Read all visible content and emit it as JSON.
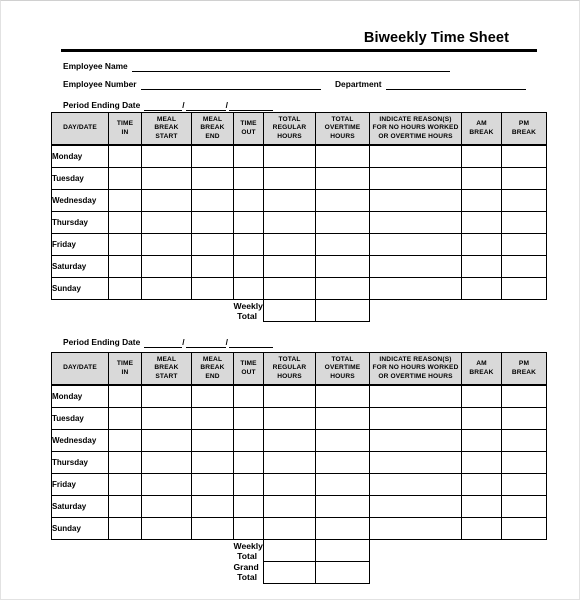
{
  "document": {
    "title": "Biweekly Time Sheet"
  },
  "header": {
    "employee_name_label": "Employee Name",
    "employee_name_value": "",
    "employee_number_label": "Employee Number",
    "employee_number_value": "",
    "department_label": "Department",
    "department_value": "",
    "period_ending_date_label": "Period Ending Date",
    "date_separator": "/"
  },
  "columns": [
    "DAY/DATE",
    "TIME IN",
    "MEAL BREAK START",
    "MEAL BREAK END",
    "TIME OUT",
    "TOTAL REGULAR HOURS",
    "TOTAL OVERTIME HOURS",
    "INDICATE REASON(S) FOR NO HOURS WORKED OR OVERTIME HOURS",
    "AM BREAK",
    "PM BREAK"
  ],
  "column_lines": {
    "day_date": [
      "DAY/DATE"
    ],
    "time_in": [
      "TIME",
      "IN"
    ],
    "meal_break_start": [
      "MEAL",
      "BREAK",
      "START"
    ],
    "meal_break_end": [
      "MEAL",
      "BREAK",
      "END"
    ],
    "time_out": [
      "TIME",
      "OUT"
    ],
    "total_regular_hours": [
      "TOTAL",
      "REGULAR",
      "HOURS"
    ],
    "total_overtime_hours": [
      "TOTAL",
      "OVERTIME",
      "HOURS"
    ],
    "indicate_reasons": [
      "INDICATE REASON(S)",
      "FOR NO HOURS WORKED",
      "OR OVERTIME HOURS"
    ],
    "am_break": [
      "AM",
      "BREAK"
    ],
    "pm_break": [
      "PM",
      "BREAK"
    ]
  },
  "period1": {
    "period_ending_date_label": "Period Ending Date",
    "rows": [
      {
        "day": "Monday",
        "time_in": "",
        "meal_break_start": "",
        "meal_break_end": "",
        "time_out": "",
        "total_regular_hours": "",
        "total_overtime_hours": "",
        "reason": "",
        "am_break": "",
        "pm_break": ""
      },
      {
        "day": "Tuesday",
        "time_in": "",
        "meal_break_start": "",
        "meal_break_end": "",
        "time_out": "",
        "total_regular_hours": "",
        "total_overtime_hours": "",
        "reason": "",
        "am_break": "",
        "pm_break": ""
      },
      {
        "day": "Wednesday",
        "time_in": "",
        "meal_break_start": "",
        "meal_break_end": "",
        "time_out": "",
        "total_regular_hours": "",
        "total_overtime_hours": "",
        "reason": "",
        "am_break": "",
        "pm_break": ""
      },
      {
        "day": "Thursday",
        "time_in": "",
        "meal_break_start": "",
        "meal_break_end": "",
        "time_out": "",
        "total_regular_hours": "",
        "total_overtime_hours": "",
        "reason": "",
        "am_break": "",
        "pm_break": ""
      },
      {
        "day": "Friday",
        "time_in": "",
        "meal_break_start": "",
        "meal_break_end": "",
        "time_out": "",
        "total_regular_hours": "",
        "total_overtime_hours": "",
        "reason": "",
        "am_break": "",
        "pm_break": ""
      },
      {
        "day": "Saturday",
        "time_in": "",
        "meal_break_start": "",
        "meal_break_end": "",
        "time_out": "",
        "total_regular_hours": "",
        "total_overtime_hours": "",
        "reason": "",
        "am_break": "",
        "pm_break": ""
      },
      {
        "day": "Sunday",
        "time_in": "",
        "meal_break_start": "",
        "meal_break_end": "",
        "time_out": "",
        "total_regular_hours": "",
        "total_overtime_hours": "",
        "reason": "",
        "am_break": "",
        "pm_break": ""
      }
    ],
    "totals": [
      {
        "label": "Weekly Total",
        "regular": "",
        "overtime": ""
      }
    ]
  },
  "period2": {
    "period_ending_date_label": "Period Ending Date",
    "rows": [
      {
        "day": "Monday",
        "time_in": "",
        "meal_break_start": "",
        "meal_break_end": "",
        "time_out": "",
        "total_regular_hours": "",
        "total_overtime_hours": "",
        "reason": "",
        "am_break": "",
        "pm_break": ""
      },
      {
        "day": "Tuesday",
        "time_in": "",
        "meal_break_start": "",
        "meal_break_end": "",
        "time_out": "",
        "total_regular_hours": "",
        "total_overtime_hours": "",
        "reason": "",
        "am_break": "",
        "pm_break": ""
      },
      {
        "day": "Wednesday",
        "time_in": "",
        "meal_break_start": "",
        "meal_break_end": "",
        "time_out": "",
        "total_regular_hours": "",
        "total_overtime_hours": "",
        "reason": "",
        "am_break": "",
        "pm_break": ""
      },
      {
        "day": "Thursday",
        "time_in": "",
        "meal_break_start": "",
        "meal_break_end": "",
        "time_out": "",
        "total_regular_hours": "",
        "total_overtime_hours": "",
        "reason": "",
        "am_break": "",
        "pm_break": ""
      },
      {
        "day": "Friday",
        "time_in": "",
        "meal_break_start": "",
        "meal_break_end": "",
        "time_out": "",
        "total_regular_hours": "",
        "total_overtime_hours": "",
        "reason": "",
        "am_break": "",
        "pm_break": ""
      },
      {
        "day": "Saturday",
        "time_in": "",
        "meal_break_start": "",
        "meal_break_end": "",
        "time_out": "",
        "total_regular_hours": "",
        "total_overtime_hours": "",
        "reason": "",
        "am_break": "",
        "pm_break": ""
      },
      {
        "day": "Sunday",
        "time_in": "",
        "meal_break_start": "",
        "meal_break_end": "",
        "time_out": "",
        "total_regular_hours": "",
        "total_overtime_hours": "",
        "reason": "",
        "am_break": "",
        "pm_break": ""
      }
    ],
    "totals": [
      {
        "label": "Weekly Total",
        "regular": "",
        "overtime": ""
      },
      {
        "label": "Grand Total",
        "regular": "",
        "overtime": ""
      }
    ]
  },
  "colors": {
    "header_fill": "#d9d9d9",
    "grid_line": "#000000",
    "text": "#000000",
    "page_background": "#ffffff"
  }
}
